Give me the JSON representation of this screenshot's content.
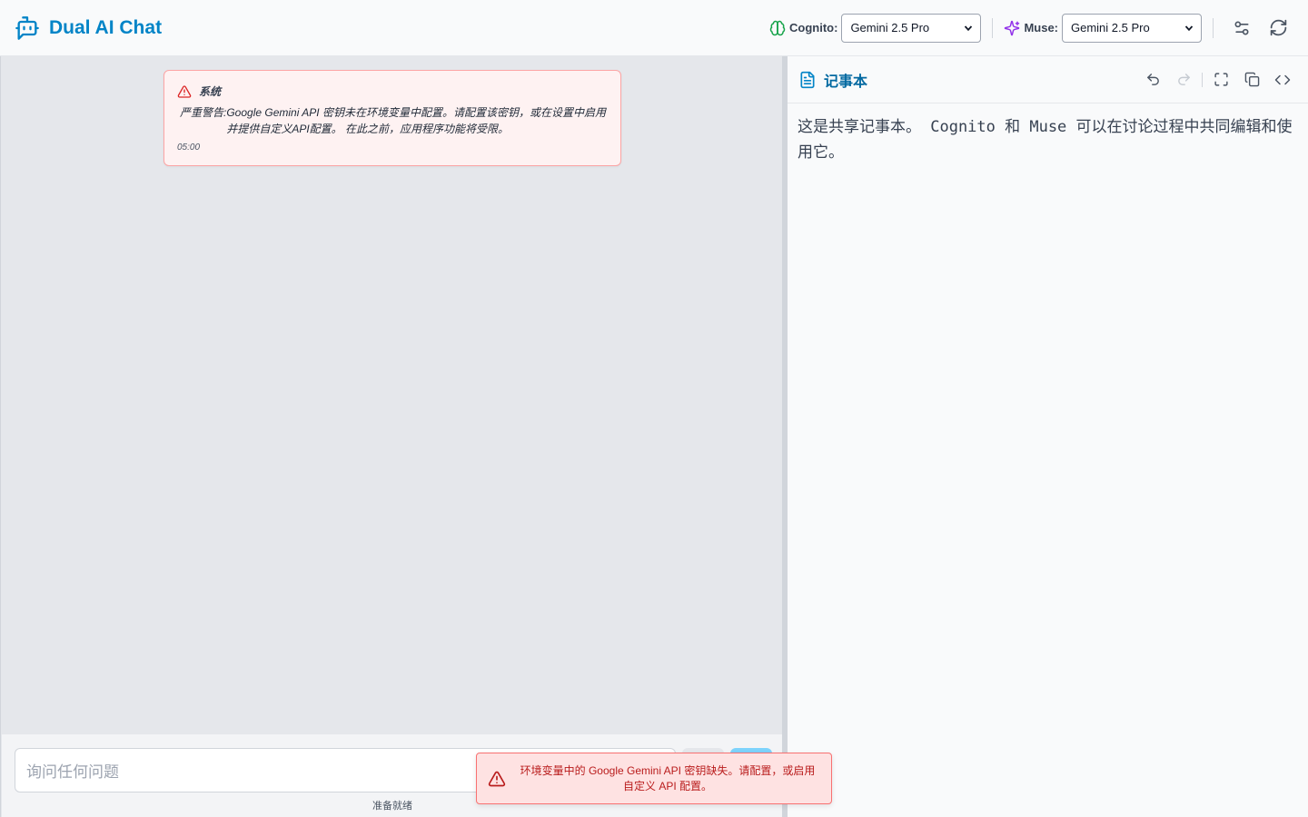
{
  "app": {
    "title": "Dual AI Chat"
  },
  "header": {
    "cognito": {
      "label": "Cognito:",
      "selected_model": "Gemini 2.5 Pro"
    },
    "muse": {
      "label": "Muse:",
      "selected_model": "Gemini 2.5 Pro"
    }
  },
  "chat": {
    "system_message": {
      "sender": "系统",
      "prefix": "严重警告:",
      "text": "Google Gemini API 密钥未在环境变量中配置。请配置该密钥，或在设置中启用并提供自定义API配置。 在此之前，应用程序功能将受限。",
      "time": "05:00"
    },
    "input": {
      "placeholder": "询问任何问题"
    },
    "status": "准备就绪"
  },
  "toast": {
    "text": "环境变量中的 Google Gemini API 密钥缺失。请配置，或启用自定义 API 配置。"
  },
  "notepad": {
    "title": "记事本",
    "content": "这是共享记事本。 Cognito 和 Muse 可以在讨论过程中共同编辑和使用它。"
  },
  "colors": {
    "brand": "#0284c7",
    "error": "#dc2626",
    "cognito_icon": "#16a34a",
    "muse_icon": "#9333ea"
  }
}
